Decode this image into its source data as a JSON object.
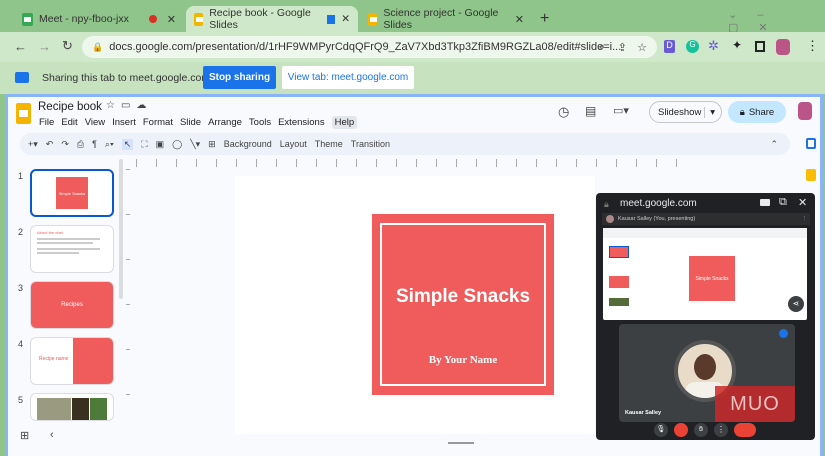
{
  "tabs": [
    {
      "title": "Meet - npy-fboo-jxx"
    },
    {
      "title": "Recipe book - Google Slides"
    },
    {
      "title": "Science project - Google Slides"
    }
  ],
  "address": {
    "url": "docs.google.com/presentation/d/1rHF9WMPyrCdqQFrQ9_ZaV7Xbd3Tkp3ZfiBM9RGZLa08/edit#slide=i..."
  },
  "sharing": {
    "text": "Sharing this tab to meet.google.com",
    "stop": "Stop sharing",
    "view": "View tab: meet.google.com"
  },
  "doc": {
    "title": "Recipe book",
    "menu": [
      "File",
      "Edit",
      "View",
      "Insert",
      "Format",
      "Slide",
      "Arrange",
      "Tools",
      "Extensions",
      "Help"
    ],
    "slideshow": "Slideshow",
    "share": "Share"
  },
  "toolbar": {
    "background": "Background",
    "layout": "Layout",
    "theme": "Theme",
    "transition": "Transition"
  },
  "slide": {
    "title": "Simple Snacks",
    "subtitle": "By Your Name",
    "color": "#f05b5b"
  },
  "thumbs": [
    {
      "n": "1",
      "text": "Simple Snacks"
    },
    {
      "n": "2",
      "text": "About the chef"
    },
    {
      "n": "3",
      "text": "Recipes"
    },
    {
      "n": "4",
      "text": "Recipe name"
    },
    {
      "n": "5",
      "text": ""
    }
  ],
  "meet": {
    "domain": "meet.google.com",
    "presenter": "Kausar Salley (You, presenting)",
    "participant": "Kausar Salley",
    "watermark": "MUO"
  }
}
